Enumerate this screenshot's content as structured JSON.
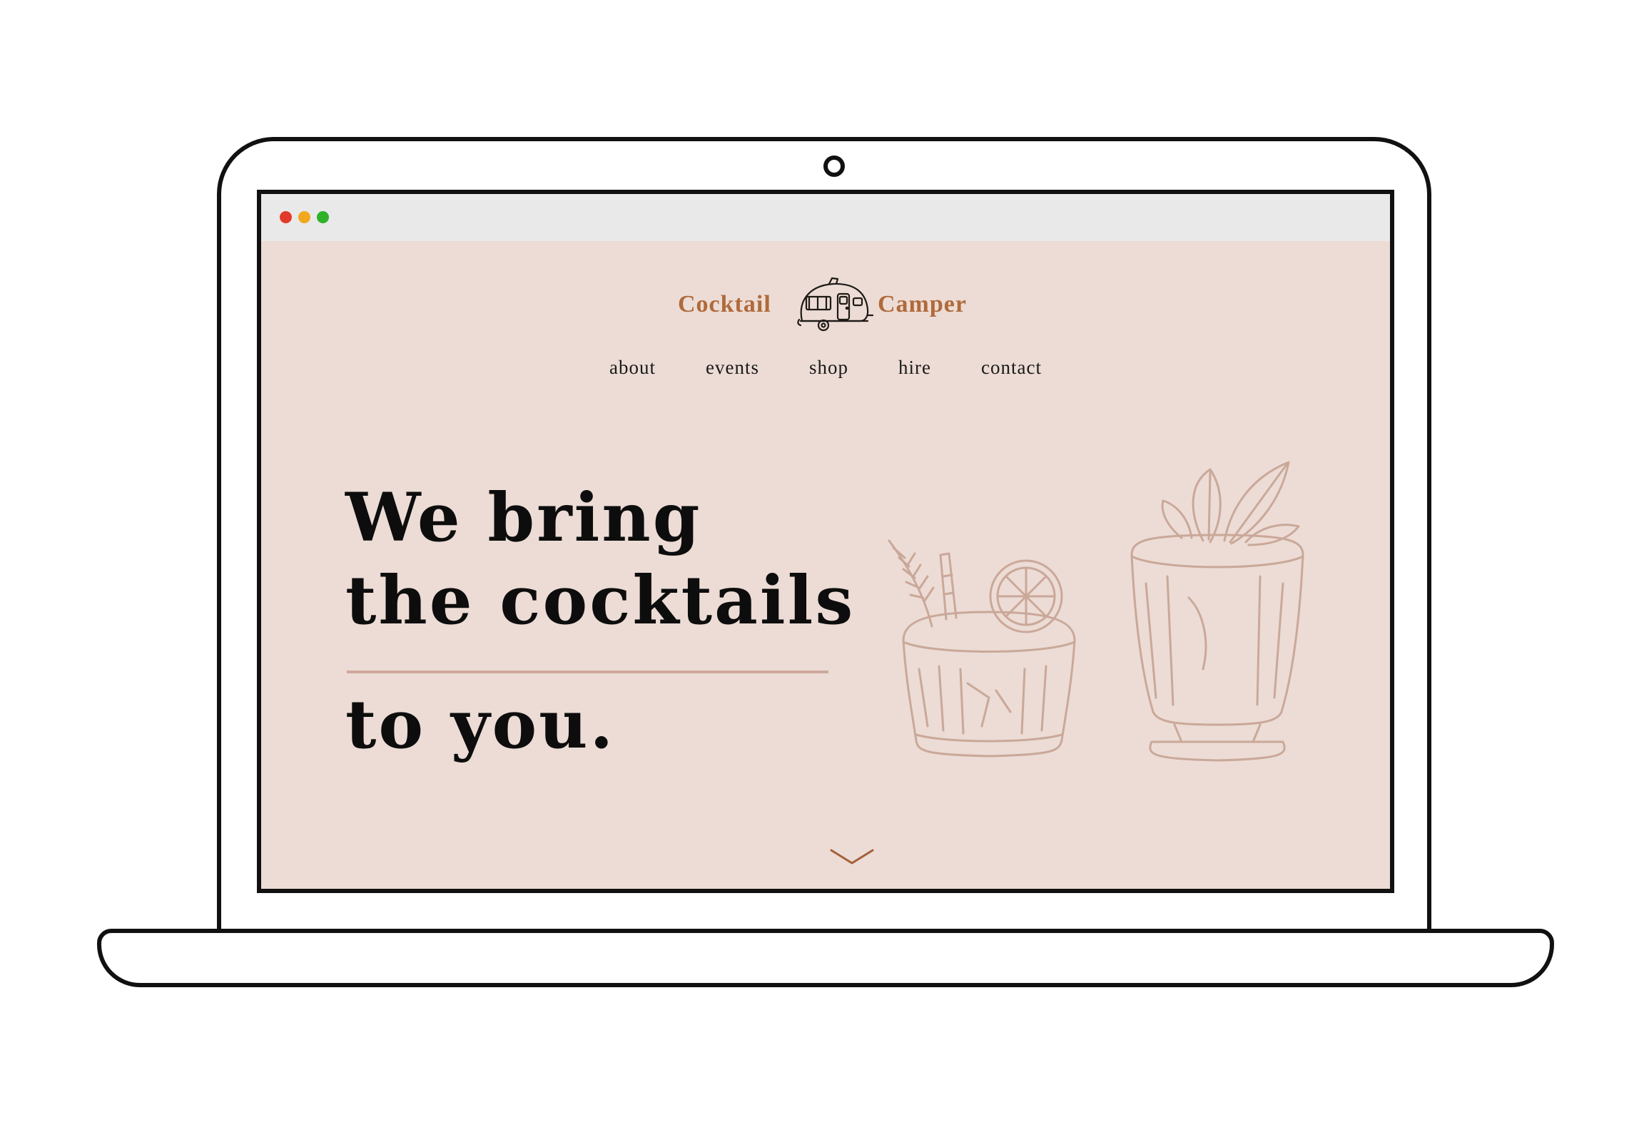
{
  "browser": {
    "controls": [
      "close",
      "minimize",
      "maximize"
    ]
  },
  "brand": {
    "name_left": "Cocktail",
    "name_right": "Camper",
    "logo_icon": "camper-trailer-icon",
    "color": "#b06a3b"
  },
  "nav": {
    "items": [
      {
        "label": "about"
      },
      {
        "label": "events"
      },
      {
        "label": "shop"
      },
      {
        "label": "hire"
      },
      {
        "label": "contact"
      }
    ]
  },
  "hero": {
    "line1": "We bring",
    "line2": "the cocktails",
    "line3": "to you.",
    "illustration": "cocktail-glasses-icon",
    "scroll_icon": "chevron-down-icon"
  },
  "colors": {
    "page_background": "#ecdcd5",
    "accent": "#cda99c",
    "text": "#0d0d0d"
  }
}
